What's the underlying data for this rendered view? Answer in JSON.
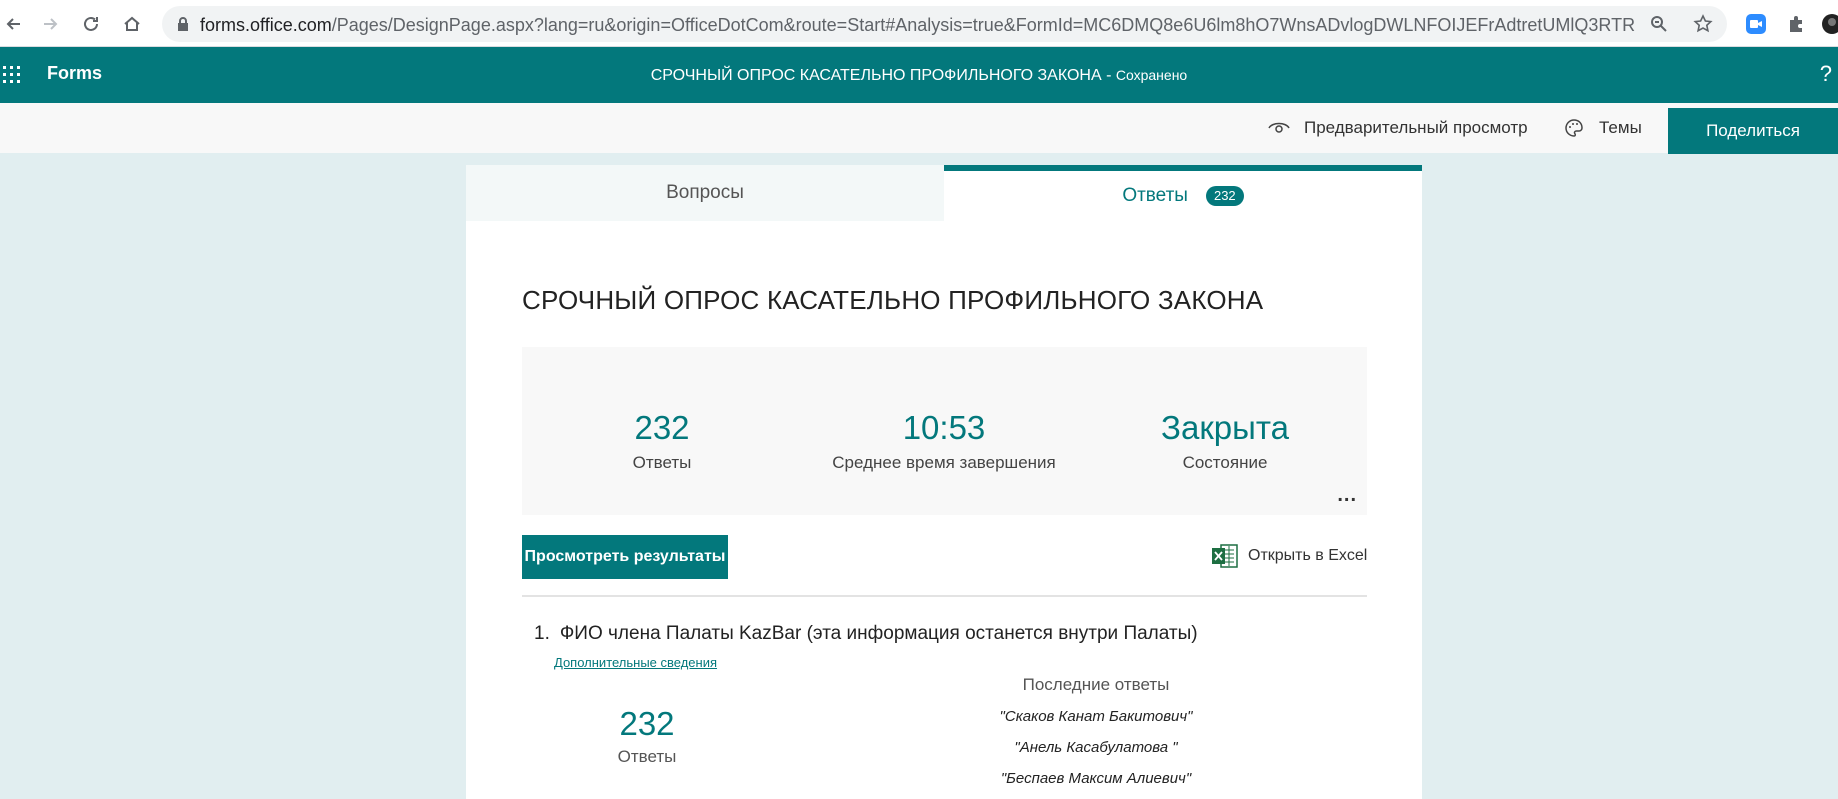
{
  "browser": {
    "url_host": "forms.office.com",
    "url_path": "/Pages/DesignPage.aspx?lang=ru&origin=OfficeDotCom&route=Start#Analysis=true&FormId=MC6DMQ8e6U6lm8hO7WnsADvlogDWLNFOIJEFrAdtretUMlQ3RTRJTFg..."
  },
  "header": {
    "app_name": "Forms",
    "form_title": "СРОЧНЫЙ ОПРОС КАСАТЕЛЬНО ПРОФИЛЬНОГО ЗАКОНА",
    "separator": " - ",
    "saved_status": "Сохранено",
    "help": "?"
  },
  "command_bar": {
    "preview_label": "Предварительный просмотр",
    "themes_label": "Темы",
    "share_label": "Поделиться"
  },
  "tabs": {
    "questions_label": "Вопросы",
    "responses_label": "Ответы",
    "responses_count": "232"
  },
  "main": {
    "title": "СРОЧНЫЙ ОПРОС КАСАТЕЛЬНО ПРОФИЛЬНОГО ЗАКОНА",
    "stats": [
      {
        "value": "232",
        "label": "Ответы"
      },
      {
        "value": "10:53",
        "label": "Среднее время завершения"
      },
      {
        "value": "Закрыта",
        "label": "Состояние"
      }
    ],
    "more_label": "...",
    "view_results_label": "Просмотреть результаты",
    "open_excel_label": "Открыть в Excel"
  },
  "question": {
    "number": "1.",
    "title": "ФИО члена Палаты KazBar (эта информация останется внутри Палаты)",
    "details_link": "Дополнительные сведения",
    "responses_value": "232",
    "responses_label": "Ответы",
    "recent_header": "Последние ответы",
    "recent_answers": [
      "\"Скаков Канат Бакитович\"",
      "\"Анель Касабулатова \"",
      "\"Беспаев Максим Алиевич\""
    ]
  },
  "colors": {
    "brand": "#03787c",
    "page_bg": "#e1eef0"
  }
}
